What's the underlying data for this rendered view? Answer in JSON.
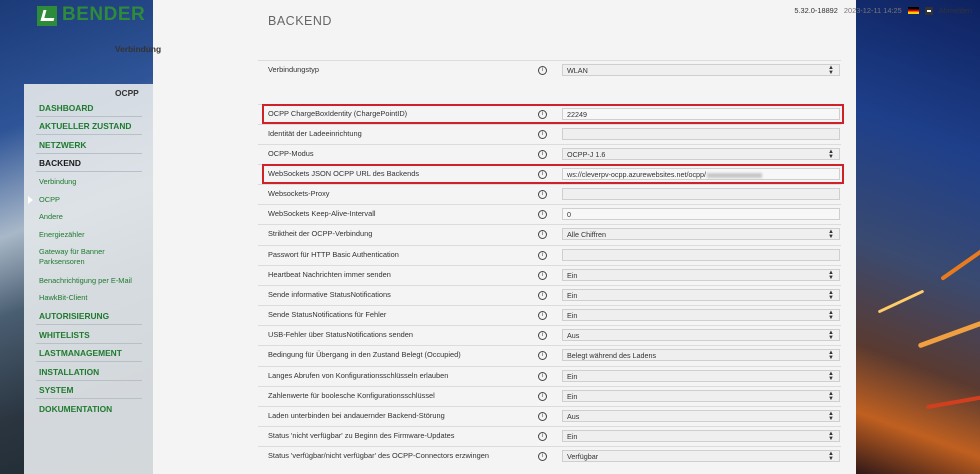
{
  "brand": {
    "name": "BENDER"
  },
  "topbar": {
    "version": "5.32.0-18892",
    "timestamp": "2023-12-11 14:25",
    "logout": "Abmelden",
    "language_flag": "de-flag-icon"
  },
  "sidebar": {
    "items": [
      {
        "label": "DASHBOARD",
        "type": "main"
      },
      {
        "label": "AKTUELLER ZUSTAND",
        "type": "main"
      },
      {
        "label": "NETZWERK",
        "type": "main"
      },
      {
        "label": "BACKEND",
        "type": "main",
        "active": true
      },
      {
        "label": "Verbindung",
        "type": "sub"
      },
      {
        "label": "OCPP",
        "type": "sub",
        "active": true
      },
      {
        "label": "Andere",
        "type": "sub"
      },
      {
        "label": "Energiezähler",
        "type": "sub"
      },
      {
        "label": "Gateway für Banner Parksensoren",
        "type": "sub"
      },
      {
        "label": "Benachrichtigung per E-Mail",
        "type": "sub"
      },
      {
        "label": "HawkBit-Client",
        "type": "sub"
      },
      {
        "label": "AUTORISIERUNG",
        "type": "main"
      },
      {
        "label": "WHITELISTS",
        "type": "main"
      },
      {
        "label": "LASTMANAGEMENT",
        "type": "main"
      },
      {
        "label": "INSTALLATION",
        "type": "main"
      },
      {
        "label": "SYSTEM",
        "type": "main"
      },
      {
        "label": "DOKUMENTATION",
        "type": "main"
      }
    ]
  },
  "page": {
    "title": "BACKEND"
  },
  "sections": {
    "verbindung": {
      "title": "Verbindung",
      "rows": [
        {
          "label": "Verbindungstyp",
          "value": "WLAN",
          "kind": "select"
        }
      ]
    },
    "ocpp": {
      "title": "OCPP",
      "rows": [
        {
          "label": "OCPP ChargeBoxIdentity (ChargePointID)",
          "value": "22249",
          "kind": "input",
          "highlight": true
        },
        {
          "label": "Identität der Ladeeinrichtung",
          "value": "",
          "kind": "input"
        },
        {
          "label": "OCPP-Modus",
          "value": "OCPP-J 1.6",
          "kind": "select"
        },
        {
          "label": "WebSockets JSON OCPP URL des Backends",
          "value": "ws://cleverpv-ocpp.azurewebsites.net/ocpp/",
          "kind": "input",
          "highlight": true,
          "blurred_suffix": true
        },
        {
          "label": "Websockets-Proxy",
          "value": "",
          "kind": "input"
        },
        {
          "label": "WebSockets Keep-Alive-Intervall",
          "value": "0",
          "kind": "input"
        },
        {
          "label": "Striktheit der OCPP-Verbindung",
          "value": "Alle Chiffren",
          "kind": "select"
        },
        {
          "label": "Passwort für HTTP Basic Authentication",
          "value": "",
          "kind": "input"
        },
        {
          "label": "Heartbeat Nachrichten immer senden",
          "value": "Ein",
          "kind": "select"
        },
        {
          "label": "Sende informative StatusNotifications",
          "value": "Ein",
          "kind": "select"
        },
        {
          "label": "Sende StatusNotifications für Fehler",
          "value": "Ein",
          "kind": "select"
        },
        {
          "label": "USB-Fehler über StatusNotifications senden",
          "value": "Aus",
          "kind": "select"
        },
        {
          "label": "Bedingung für Übergang in den Zustand Belegt (Occupied)",
          "value": "Belegt während des Ladens",
          "kind": "select"
        },
        {
          "label": "Langes Abrufen von Konfigurationsschlüsseln erlauben",
          "value": "Ein",
          "kind": "select"
        },
        {
          "label": "Zahlenwerte für boolesche Konfigurationsschlüssel",
          "value": "Ein",
          "kind": "select"
        },
        {
          "label": "Laden unterbinden bei andauernder Backend-Störung",
          "value": "Aus",
          "kind": "select"
        },
        {
          "label": "Status 'nicht verfügbar' zu Beginn des Firmware-Updates",
          "value": "Ein",
          "kind": "select"
        },
        {
          "label": "Status 'verfügbar/nicht verfügbar' des OCPP-Connectors erzwingen",
          "value": "Verfügbar",
          "kind": "select"
        }
      ]
    }
  },
  "colors": {
    "brand_green": "#2e8b3a",
    "highlight_red": "#d0202a",
    "nav_green": "#1f7a2e"
  }
}
